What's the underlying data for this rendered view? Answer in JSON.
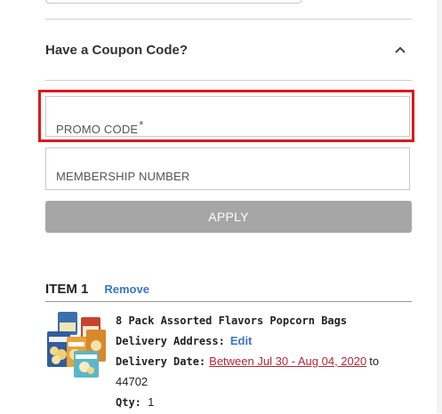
{
  "coupon": {
    "title": "Have a Coupon Code?",
    "toggle_icon": "chevron-up-icon",
    "promo_placeholder": "PROMO CODE",
    "promo_required_mark": "*",
    "membership_placeholder": "MEMBERSHIP NUMBER",
    "apply_label": "APPLY"
  },
  "item": {
    "label": "ITEM 1",
    "remove_label": "Remove",
    "product_name": "8 Pack Assorted Flavors Popcorn Bags",
    "delivery_address_label": "Delivery Address:",
    "edit_label": "Edit",
    "delivery_date_label": "Delivery Date:",
    "delivery_date_value": "Between Jul 30 - Aug 04, 2020",
    "to_label": "to",
    "zip": "44702",
    "qty_label": "Qty:",
    "qty_value": "1",
    "image_icon": "popcorn-bags-image"
  },
  "colors": {
    "highlight": "#e0171b",
    "link": "#3a76c4",
    "date_link": "#b0283a",
    "apply_disabled": "#a6a6a6"
  }
}
